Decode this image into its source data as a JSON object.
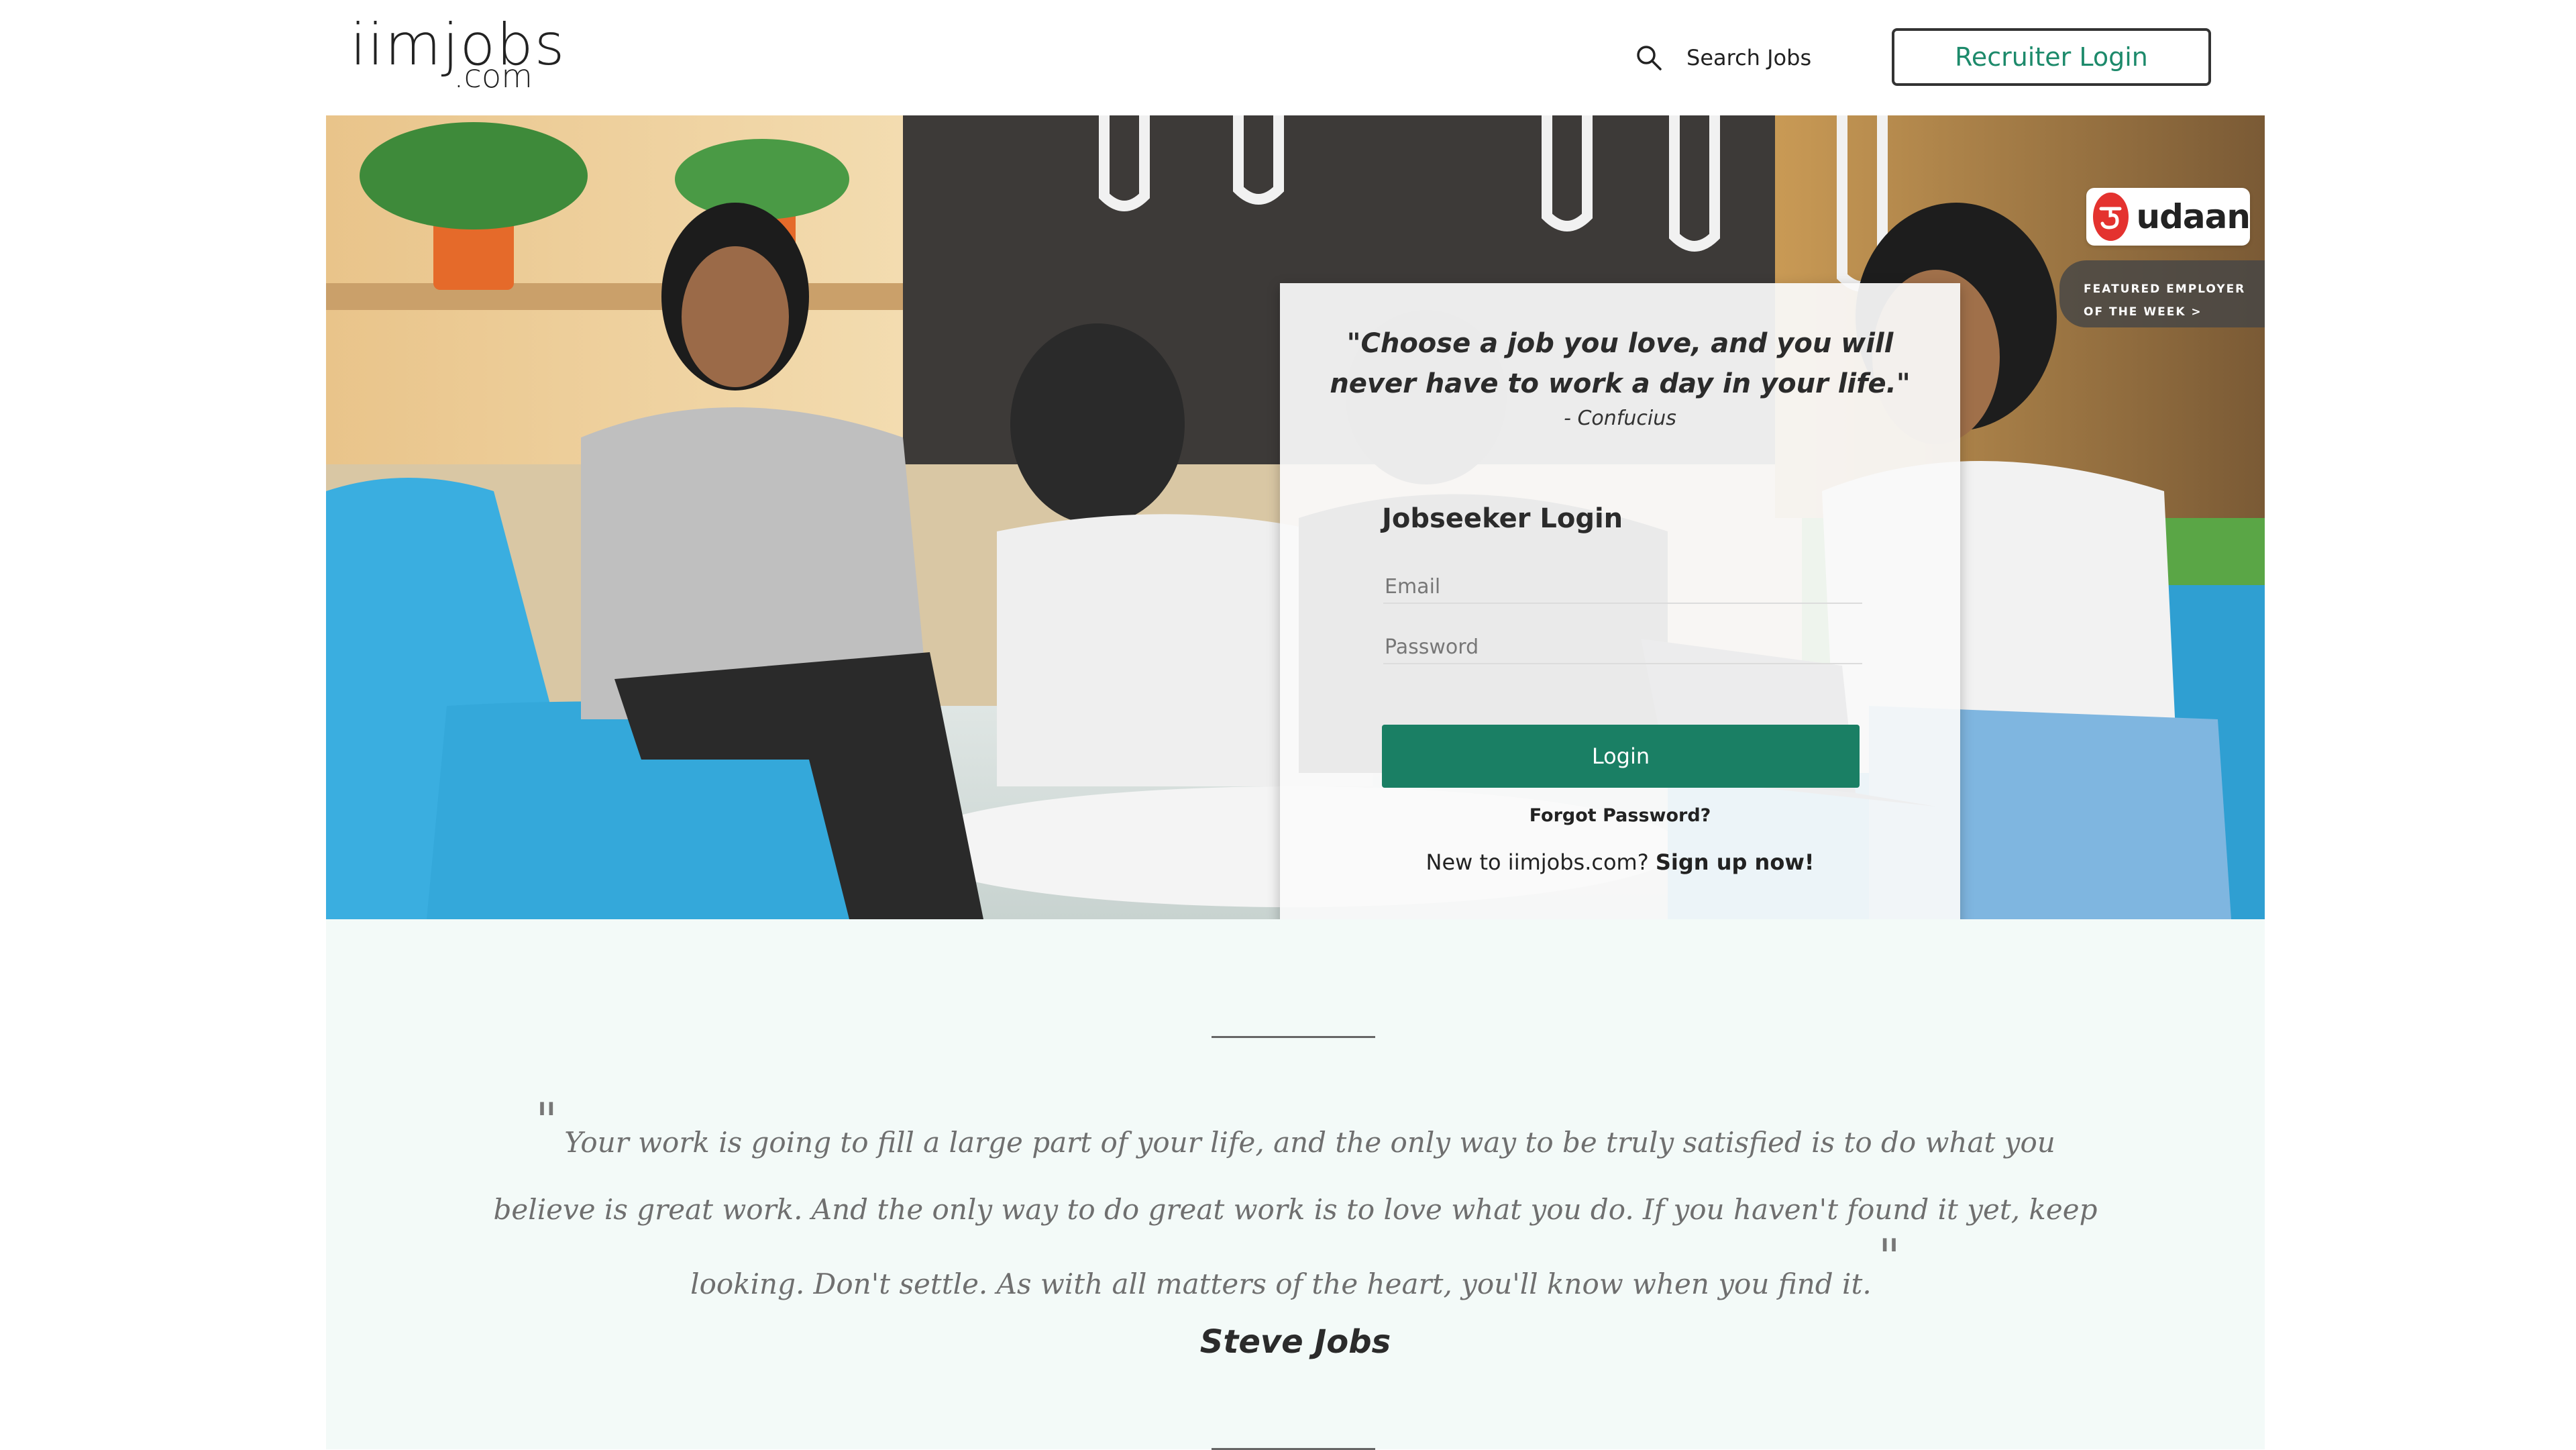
{
  "header": {
    "logo_main": "iimjobs",
    "logo_sub": ".com",
    "search_label": "Search Jobs",
    "recruiter_login": "Recruiter Login"
  },
  "hero": {
    "quote": "\"Choose a job you love, and you will never have to work a day in your life.\"",
    "quote_author": "- Confucius",
    "login": {
      "title": "Jobseeker Login",
      "email_placeholder": "Email",
      "email_value": "",
      "password_placeholder": "Password",
      "password_value": "",
      "button_label": "Login",
      "forgot_password": "Forgot Password?",
      "signup_prompt": "New to iimjobs.com?",
      "signup_link": "Sign up now!"
    },
    "featured": {
      "brand_name": "udaan",
      "tag": "FEATURED EMPLOYER OF THE WEEK >"
    }
  },
  "quote_band": {
    "open_mark": "\"",
    "text": "Your work is going to fill a large part of your life, and the only way to be truly satisfied is to do what you believe is great work. And the only way to do great work is to love what you do. If you haven't found it yet, keep looking. Don't settle. As with all matters of the heart, you'll know when you find it.",
    "close_mark": "\"",
    "author": "Steve Jobs"
  },
  "colors": {
    "brand_green": "#1a7f64",
    "recruiter_text": "#1d8a6b",
    "band_background": "#f3faf8",
    "udaan_red": "#e4322f"
  },
  "icons": {
    "search": "search-icon",
    "udaan": "udaan-logo-icon"
  }
}
